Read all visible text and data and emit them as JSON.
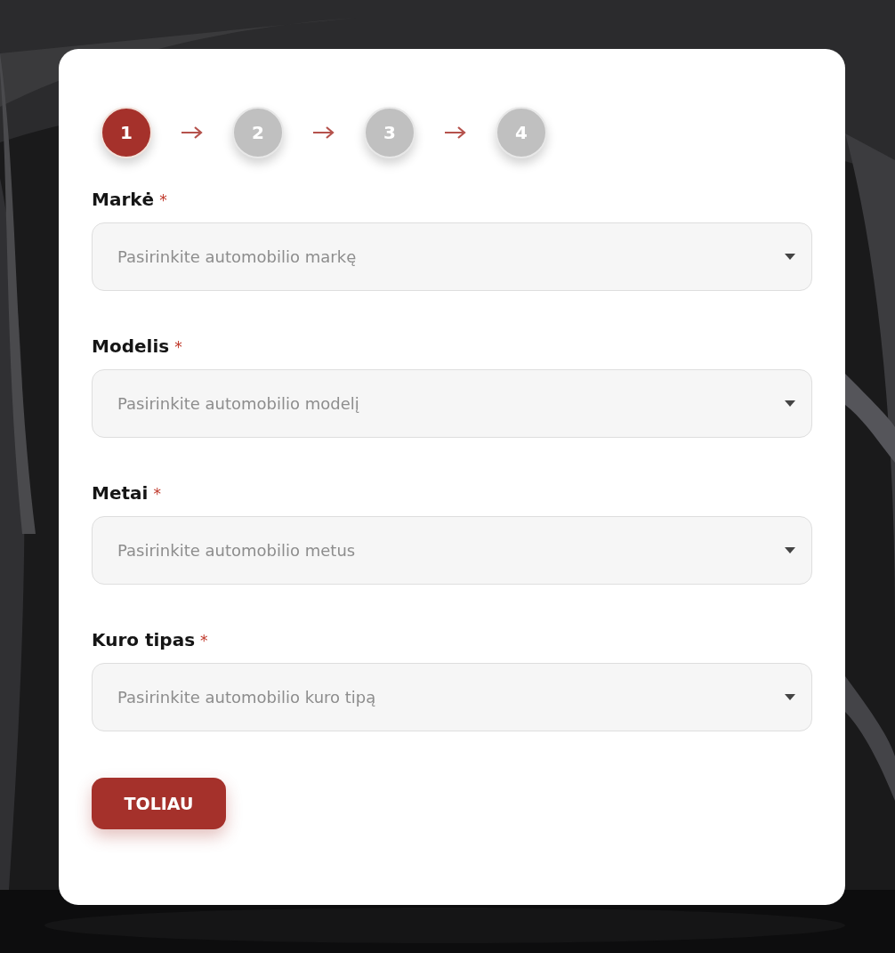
{
  "steps": [
    {
      "number": "1",
      "selected": true
    },
    {
      "number": "2",
      "selected": false
    },
    {
      "number": "3",
      "selected": false
    },
    {
      "number": "4",
      "selected": false
    }
  ],
  "fields": [
    {
      "label": "Markė",
      "required_mark": "*",
      "placeholder": "Pasirinkite automobilio markę"
    },
    {
      "label": "Modelis",
      "required_mark": "*",
      "placeholder": "Pasirinkite automobilio modelį"
    },
    {
      "label": "Metai",
      "required_mark": "*",
      "placeholder": "Pasirinkite automobilio metus"
    },
    {
      "label": "Kuro tipas",
      "required_mark": "*",
      "placeholder": "Pasirinkite automobilio kuro tipą"
    }
  ],
  "button": "TOLIAU"
}
